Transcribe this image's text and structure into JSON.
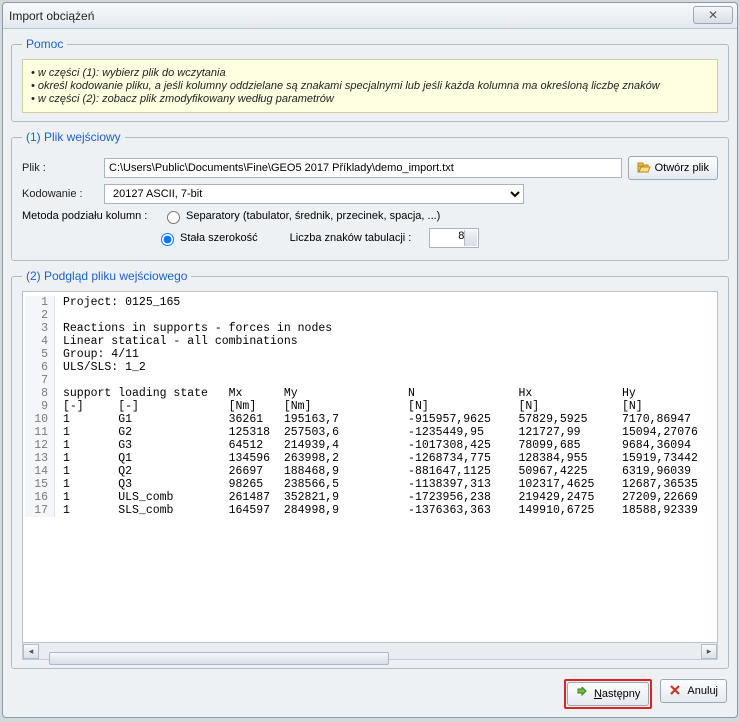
{
  "window": {
    "title": "Import obciążeń",
    "close": "✕"
  },
  "help": {
    "legend": "Pomoc",
    "line1": "• w części (1): wybierz plik do wczytania",
    "line2": "• określ kodowanie pliku, a jeśli kolumny oddzielane są znakami specjalnymi lub jeśli każda kolumna ma określoną liczbę znaków",
    "line3": "• w części (2): zobacz plik zmodyfikowany według parametrów"
  },
  "input": {
    "legend": "(1) Plik wejściowy",
    "file_label": "Plik :",
    "file_value": "C:\\Users\\Public\\Documents\\Fine\\GEO5 2017 Příklady\\demo_import.txt",
    "open_btn": "Otwórz plik",
    "encoding_label": "Kodowanie :",
    "encoding_value": "20127 ASCII, 7-bit",
    "split_label": "Metoda podziału kolumn :",
    "sep_label": "Separatory (tabulator, średnik, przecinek, spacja, ...)",
    "fixed_label": "Stała szerokość",
    "tab_label": "Liczba znaków tabulacji :",
    "tab_value": "8"
  },
  "preview": {
    "legend": "(2) Podgląd pliku wejściowego",
    "lines": [
      "Project: 0125_165",
      "",
      "Reactions in supports - forces in nodes",
      "Linear statical - all combinations",
      "Group: 4/11",
      "ULS/SLS: 1_2",
      "",
      "support loading state   Mx      My                N               Hx             Hy",
      "[-]     [-]             [Nm]    [Nm]              [N]             [N]            [N]",
      "1       G1              36261   195163,7          -915957,9625    57829,5925     7170,86947",
      "1       G2              125318  257503,6          -1235449,95     121727,99      15094,27076",
      "1       G3              64512   214939,4          -1017308,425    78099,685      9684,36094",
      "1       Q1              134596  263998,2          -1268734,775    128384,955     15919,73442",
      "1       Q2              26697   188468,9          -881647,1125    50967,4225     6319,96039",
      "1       Q3              98265   238566,5          -1138397,313    102317,4625    12687,36535",
      "1       ULS_comb        261487  352821,9          -1723956,238    219429,2475    27209,22669",
      "1       SLS_comb        164597  284998,9          -1376363,363    149910,6725    18588,92339"
    ]
  },
  "footer": {
    "next": "Następny",
    "cancel": "Anuluj"
  }
}
